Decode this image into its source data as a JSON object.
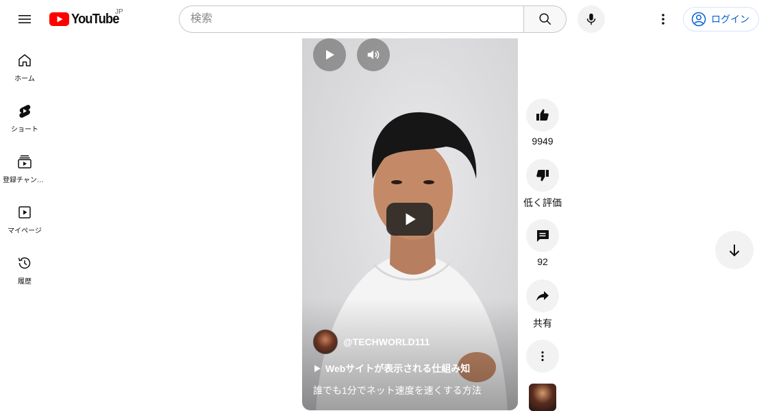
{
  "header": {
    "logo_text": "YouTube",
    "region": "JP",
    "search_placeholder": "検索",
    "login_label": "ログイン"
  },
  "sidebar": {
    "items": [
      {
        "label": "ホーム",
        "icon": "home-icon"
      },
      {
        "label": "ショート",
        "icon": "shorts-icon"
      },
      {
        "label": "登録チャンネル",
        "icon": "subscriptions-icon"
      },
      {
        "label": "マイページ",
        "icon": "library-icon"
      },
      {
        "label": "履歴",
        "icon": "history-icon"
      }
    ]
  },
  "video": {
    "channel_name": "@TECHWORLD111",
    "playlist_label": "Webサイトが表示される仕組み知",
    "title": "誰でも1分でネット速度を速くする方法"
  },
  "actions": {
    "like_count": "9949",
    "dislike_label": "低く評価",
    "comment_count": "92",
    "share_label": "共有"
  },
  "colors": {
    "brand_red": "#ff0000",
    "link_blue": "#065fd4",
    "button_gray": "#f2f2f2"
  }
}
